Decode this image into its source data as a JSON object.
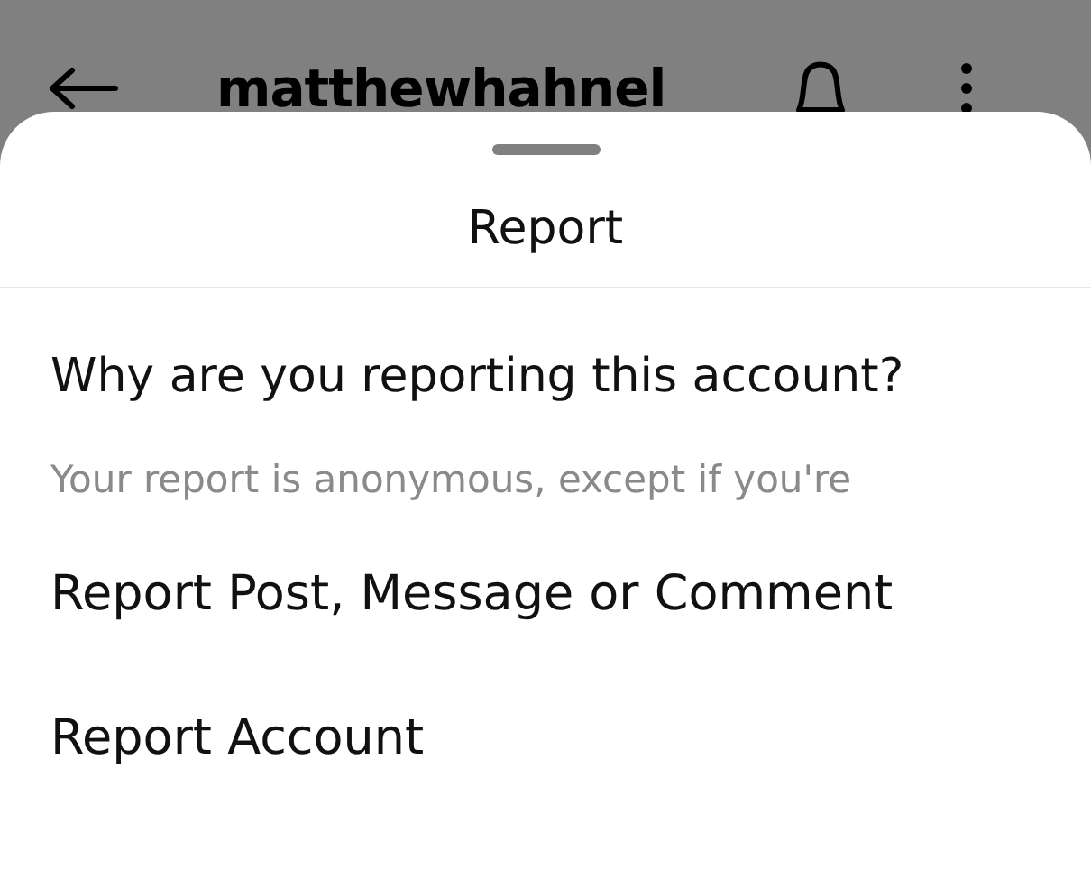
{
  "header": {
    "title": "matthewhahnel"
  },
  "sheet": {
    "title": "Report",
    "question": "Why are you reporting this account?",
    "note": "Your report is anonymous, except if you're",
    "options": [
      {
        "label": "Report Post, Message or Comment"
      },
      {
        "label": "Report Account"
      }
    ]
  }
}
